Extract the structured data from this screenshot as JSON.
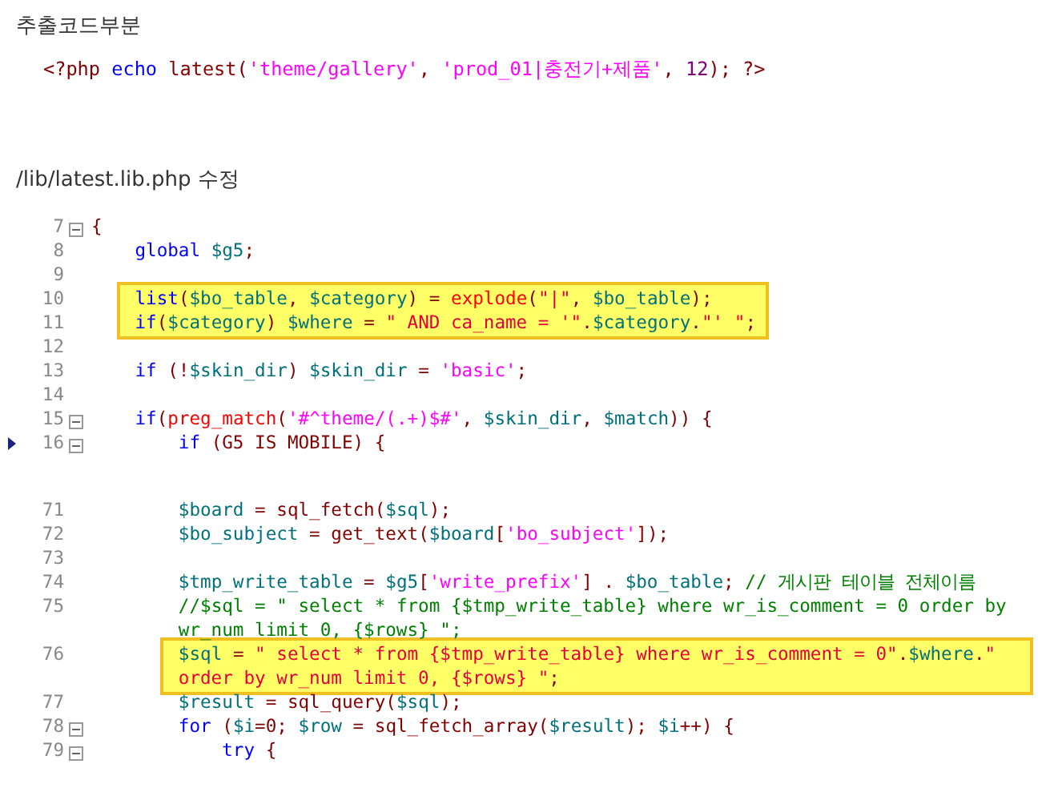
{
  "snippet_heading": "추출코드부분",
  "snippet": {
    "tokens": [
      {
        "kind": "fn",
        "text": "<?php"
      },
      {
        "kind": "kw",
        "text": " echo "
      },
      {
        "kind": "fn",
        "text": "latest"
      },
      {
        "kind": "punc",
        "text": "("
      },
      {
        "kind": "str1",
        "text": "'theme/gallery'"
      },
      {
        "kind": "punc",
        "text": ", "
      },
      {
        "kind": "str1",
        "text": "'prod_01|충전기+제품'"
      },
      {
        "kind": "punc",
        "text": ", "
      },
      {
        "kind": "num",
        "text": "12"
      },
      {
        "kind": "punc",
        "text": "); "
      },
      {
        "kind": "fn",
        "text": "?>"
      }
    ]
  },
  "file_heading": "/lib/latest.lib.php 수정",
  "code": {
    "excerpts": [
      {
        "lines": [
          {
            "number": "7",
            "fold": true,
            "current": false,
            "highlighted": false,
            "tokens": [
              {
                "kind": "punc",
                "text": "{"
              }
            ]
          },
          {
            "number": "8",
            "fold": false,
            "current": false,
            "highlighted": false,
            "tokens": [
              {
                "kind": "kw",
                "text": "    global "
              },
              {
                "kind": "var",
                "text": "$g5"
              },
              {
                "kind": "punc",
                "text": ";"
              }
            ]
          },
          {
            "number": "9",
            "fold": false,
            "current": false,
            "highlighted": false
          },
          {
            "number": "10",
            "fold": false,
            "current": false,
            "highlighted": true,
            "tokens": [
              {
                "kind": "kw",
                "text": "    list"
              },
              {
                "kind": "punc",
                "text": "("
              },
              {
                "kind": "var",
                "text": "$bo_table"
              },
              {
                "kind": "punc",
                "text": ", "
              },
              {
                "kind": "var",
                "text": "$category"
              },
              {
                "kind": "punc",
                "text": ") = "
              },
              {
                "kind": "builtin",
                "text": "explode"
              },
              {
                "kind": "punc",
                "text": "("
              },
              {
                "kind": "str2",
                "text": "\"|\""
              },
              {
                "kind": "punc",
                "text": ", "
              },
              {
                "kind": "var",
                "text": "$bo_table"
              },
              {
                "kind": "punc",
                "text": ");"
              }
            ]
          },
          {
            "number": "11",
            "fold": false,
            "current": false,
            "highlighted": true,
            "tokens": [
              {
                "kind": "kw",
                "text": "    if"
              },
              {
                "kind": "punc",
                "text": "("
              },
              {
                "kind": "var",
                "text": "$category"
              },
              {
                "kind": "punc",
                "text": ") "
              },
              {
                "kind": "var",
                "text": "$where"
              },
              {
                "kind": "punc",
                "text": " = "
              },
              {
                "kind": "str2",
                "text": "\" AND ca_name = '\""
              },
              {
                "kind": "punc",
                "text": "."
              },
              {
                "kind": "var",
                "text": "$category"
              },
              {
                "kind": "punc",
                "text": "."
              },
              {
                "kind": "str2",
                "text": "\"' \""
              },
              {
                "kind": "punc",
                "text": ";"
              }
            ]
          },
          {
            "number": "12",
            "fold": false,
            "current": false,
            "highlighted": false
          },
          {
            "number": "13",
            "fold": false,
            "current": false,
            "highlighted": false,
            "tokens": [
              {
                "kind": "kw",
                "text": "    if"
              },
              {
                "kind": "punc",
                "text": " (!"
              },
              {
                "kind": "var",
                "text": "$skin_dir"
              },
              {
                "kind": "punc",
                "text": ") "
              },
              {
                "kind": "var",
                "text": "$skin_dir"
              },
              {
                "kind": "punc",
                "text": " = "
              },
              {
                "kind": "str1",
                "text": "'basic'"
              },
              {
                "kind": "punc",
                "text": ";"
              }
            ]
          },
          {
            "number": "14",
            "fold": false,
            "current": false,
            "highlighted": false
          },
          {
            "number": "15",
            "fold": true,
            "current": false,
            "highlighted": false,
            "tokens": [
              {
                "kind": "kw",
                "text": "    if"
              },
              {
                "kind": "punc",
                "text": "("
              },
              {
                "kind": "builtin",
                "text": "preg_match"
              },
              {
                "kind": "punc",
                "text": "("
              },
              {
                "kind": "str1",
                "text": "'#^theme/(.+)$#'"
              },
              {
                "kind": "punc",
                "text": ", "
              },
              {
                "kind": "var",
                "text": "$skin_dir"
              },
              {
                "kind": "punc",
                "text": ", "
              },
              {
                "kind": "var",
                "text": "$match"
              },
              {
                "kind": "punc",
                "text": ")) {"
              }
            ]
          },
          {
            "number": "16",
            "fold": true,
            "current": true,
            "highlighted": false,
            "tokens": [
              {
                "kind": "kw",
                "text": "        if"
              },
              {
                "kind": "punc",
                "text": " (G5 IS MOBILE) {"
              }
            ]
          }
        ]
      },
      {
        "lines": [
          {
            "number": "71",
            "fold": false,
            "current": false,
            "highlighted": false,
            "tokens": [
              {
                "kind": "var",
                "text": "        $board"
              },
              {
                "kind": "punc",
                "text": " = "
              },
              {
                "kind": "fn",
                "text": "sql_fetch"
              },
              {
                "kind": "punc",
                "text": "("
              },
              {
                "kind": "var",
                "text": "$sql"
              },
              {
                "kind": "punc",
                "text": ");"
              }
            ]
          },
          {
            "number": "72",
            "fold": false,
            "current": false,
            "highlighted": false,
            "tokens": [
              {
                "kind": "var",
                "text": "        $bo_subject"
              },
              {
                "kind": "punc",
                "text": " = "
              },
              {
                "kind": "fn",
                "text": "get_text"
              },
              {
                "kind": "punc",
                "text": "("
              },
              {
                "kind": "var",
                "text": "$board"
              },
              {
                "kind": "punc",
                "text": "["
              },
              {
                "kind": "str1",
                "text": "'bo_subject'"
              },
              {
                "kind": "punc",
                "text": "]);"
              }
            ]
          },
          {
            "number": "73",
            "fold": false,
            "current": false,
            "highlighted": false
          },
          {
            "number": "74",
            "fold": false,
            "current": false,
            "highlighted": false,
            "tokens": [
              {
                "kind": "var",
                "text": "        $tmp_write_table"
              },
              {
                "kind": "punc",
                "text": " = "
              },
              {
                "kind": "var",
                "text": "$g5"
              },
              {
                "kind": "punc",
                "text": "["
              },
              {
                "kind": "str1",
                "text": "'write_prefix'"
              },
              {
                "kind": "punc",
                "text": "] . "
              },
              {
                "kind": "var",
                "text": "$bo_table"
              },
              {
                "kind": "punc",
                "text": "; "
              },
              {
                "kind": "comment",
                "text": "// 게시판 테이블 전체이름"
              }
            ]
          },
          {
            "number": "75",
            "fold": false,
            "current": false,
            "highlighted": false,
            "tokens": [
              {
                "kind": "comment",
                "text": "        //$sql = \" select * from {$tmp_write_table} where wr_is_comment = 0 order by wr_num limit 0, {$rows} \";"
              }
            ]
          },
          {
            "number": "76",
            "fold": false,
            "current": false,
            "highlighted": true,
            "tokens": [
              {
                "kind": "var",
                "text": "        $sql"
              },
              {
                "kind": "punc",
                "text": " = "
              },
              {
                "kind": "str2",
                "text": "\" select * from {$tmp_write_table} where wr_is_comment = 0\""
              },
              {
                "kind": "punc",
                "text": "."
              },
              {
                "kind": "var",
                "text": "$where"
              },
              {
                "kind": "punc",
                "text": "."
              },
              {
                "kind": "str2",
                "text": "\" order by wr_num limit 0, {$rows} \""
              },
              {
                "kind": "punc",
                "text": ";"
              }
            ]
          },
          {
            "number": "77",
            "fold": false,
            "current": false,
            "highlighted": false,
            "tokens": [
              {
                "kind": "var",
                "text": "        $result"
              },
              {
                "kind": "punc",
                "text": " = "
              },
              {
                "kind": "fn",
                "text": "sql_query"
              },
              {
                "kind": "punc",
                "text": "("
              },
              {
                "kind": "var",
                "text": "$sql"
              },
              {
                "kind": "punc",
                "text": ");"
              }
            ]
          },
          {
            "number": "78",
            "fold": true,
            "current": false,
            "highlighted": false,
            "tokens": [
              {
                "kind": "kw",
                "text": "        for"
              },
              {
                "kind": "punc",
                "text": " ("
              },
              {
                "kind": "var",
                "text": "$i"
              },
              {
                "kind": "punc",
                "text": "=0; "
              },
              {
                "kind": "var",
                "text": "$row"
              },
              {
                "kind": "punc",
                "text": " = "
              },
              {
                "kind": "fn",
                "text": "sql_fetch_array"
              },
              {
                "kind": "punc",
                "text": "("
              },
              {
                "kind": "var",
                "text": "$result"
              },
              {
                "kind": "punc",
                "text": "); "
              },
              {
                "kind": "var",
                "text": "$i"
              },
              {
                "kind": "punc",
                "text": "++) {"
              }
            ]
          },
          {
            "number": "79",
            "fold": true,
            "current": false,
            "highlighted": false,
            "tokens": [
              {
                "kind": "kw",
                "text": "            try"
              },
              {
                "kind": "punc",
                "text": " {"
              }
            ]
          }
        ]
      }
    ]
  }
}
